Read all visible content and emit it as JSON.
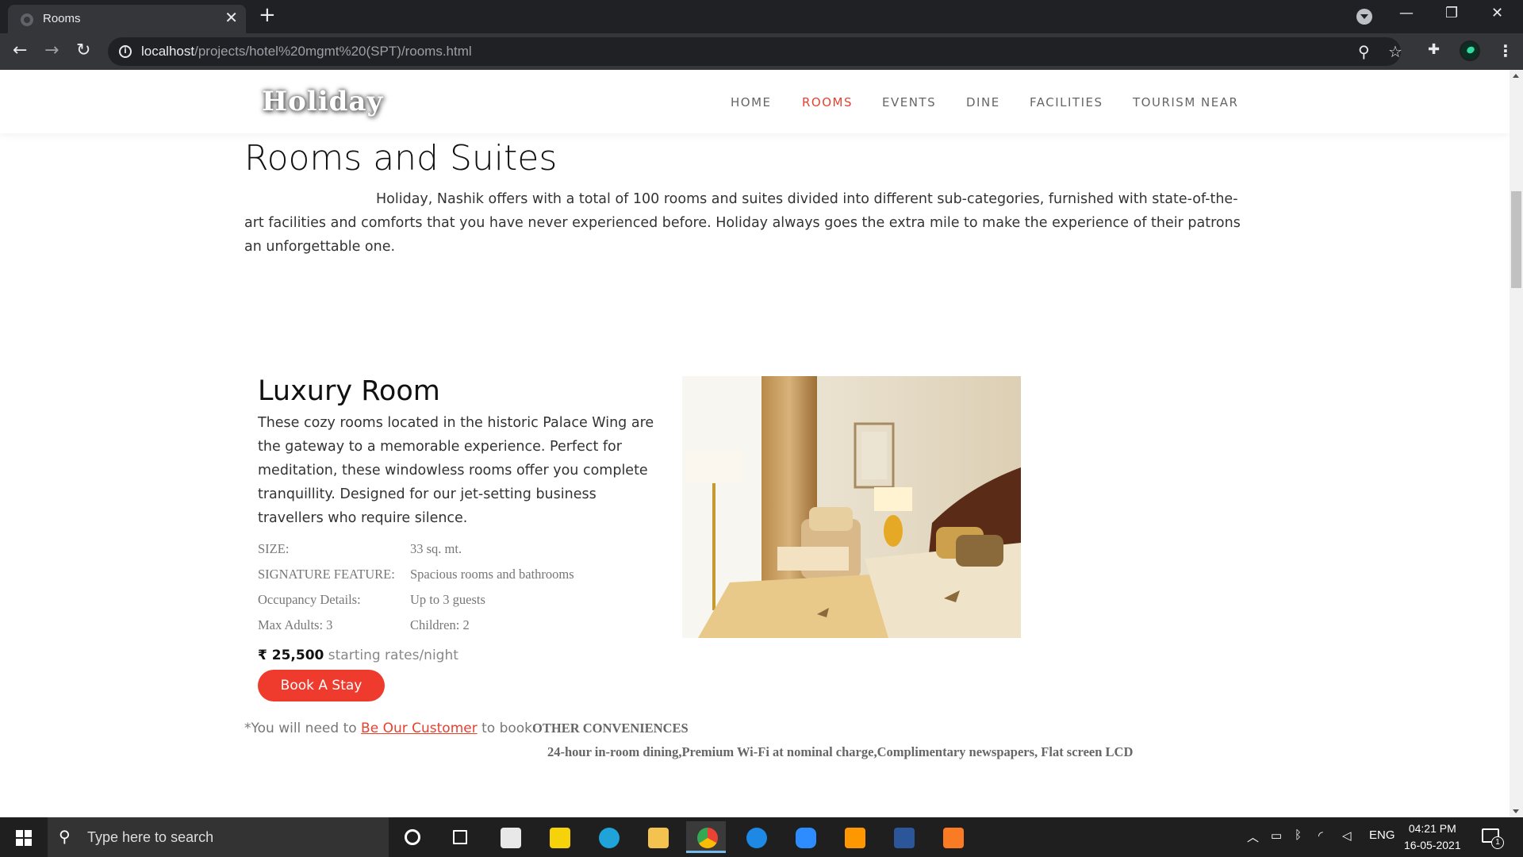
{
  "browser": {
    "tab_title": "Rooms",
    "tab_close": "✕",
    "new_tab": "+",
    "url_host": "localhost",
    "url_path": "/projects/hotel%20mgmt%20(SPT)/rooms.html",
    "icons": [
      "back-arrow-icon",
      "forward-arrow-icon",
      "reload-icon",
      "info-icon",
      "zoom-icon",
      "star-icon",
      "extensions-icon",
      "profile-avatar",
      "menu-dots-icon"
    ]
  },
  "site": {
    "logo": "Holiday",
    "nav": [
      {
        "label": "HOME",
        "active": false
      },
      {
        "label": "ROOMS",
        "active": true
      },
      {
        "label": "EVENTS",
        "active": false
      },
      {
        "label": "DINE",
        "active": false
      },
      {
        "label": "FACILITIES",
        "active": false
      },
      {
        "label": "TOURISM NEAR",
        "active": false
      }
    ],
    "accent_color": "#ef3b2d"
  },
  "page": {
    "title": "Rooms and Suites",
    "intro": "Holiday, Nashik offers with a total of 100 rooms and suites divided into different sub-categories, furnished with state-of-the-art facilities and comforts that you have never experienced before. Holiday always goes the extra mile to make the experience of their patrons an unforgettable one."
  },
  "room": {
    "title": "Luxury Room",
    "description": "These cozy rooms located in the historic Palace Wing are the gateway to a memorable experience. Perfect for meditation, these windowless rooms offer you complete tranquillity. Designed for our jet-setting business travellers who require silence.",
    "specs": [
      {
        "label": "SIZE:",
        "value": "33 sq. mt."
      },
      {
        "label": "SIGNATURE FEATURE:",
        "value": "Spacious rooms and bathrooms"
      },
      {
        "label": "Occupancy Details:",
        "value": "Up to 3 guests"
      },
      {
        "label": "Max Adults: 3",
        "value": "Children: 2"
      }
    ],
    "price": "₹ 25,500",
    "price_suffix": "starting rates/night",
    "book_button": "Book A Stay",
    "note_prefix": "*You will need to ",
    "note_link": "Be Our Customer",
    "note_suffix": " to book",
    "conveniences_title": "OTHER CONVENIENCES",
    "conveniences": "24-hour in-room dining,Premium Wi-Fi at nominal charge,Complimentary newspapers, Flat screen LCD"
  },
  "taskbar": {
    "search_placeholder": "Type here to search",
    "apps": [
      "cortana-icon",
      "task-view-icon",
      "store-icon",
      "sticky-notes-icon",
      "edge-icon",
      "file-explorer-icon",
      "chrome-icon",
      "safari-icon",
      "zoom-app-icon",
      "sublime-icon",
      "word-icon",
      "xampp-icon"
    ],
    "lang": "ENG",
    "time": "04:21 PM",
    "date": "16-05-2021",
    "notification_count": "1"
  }
}
